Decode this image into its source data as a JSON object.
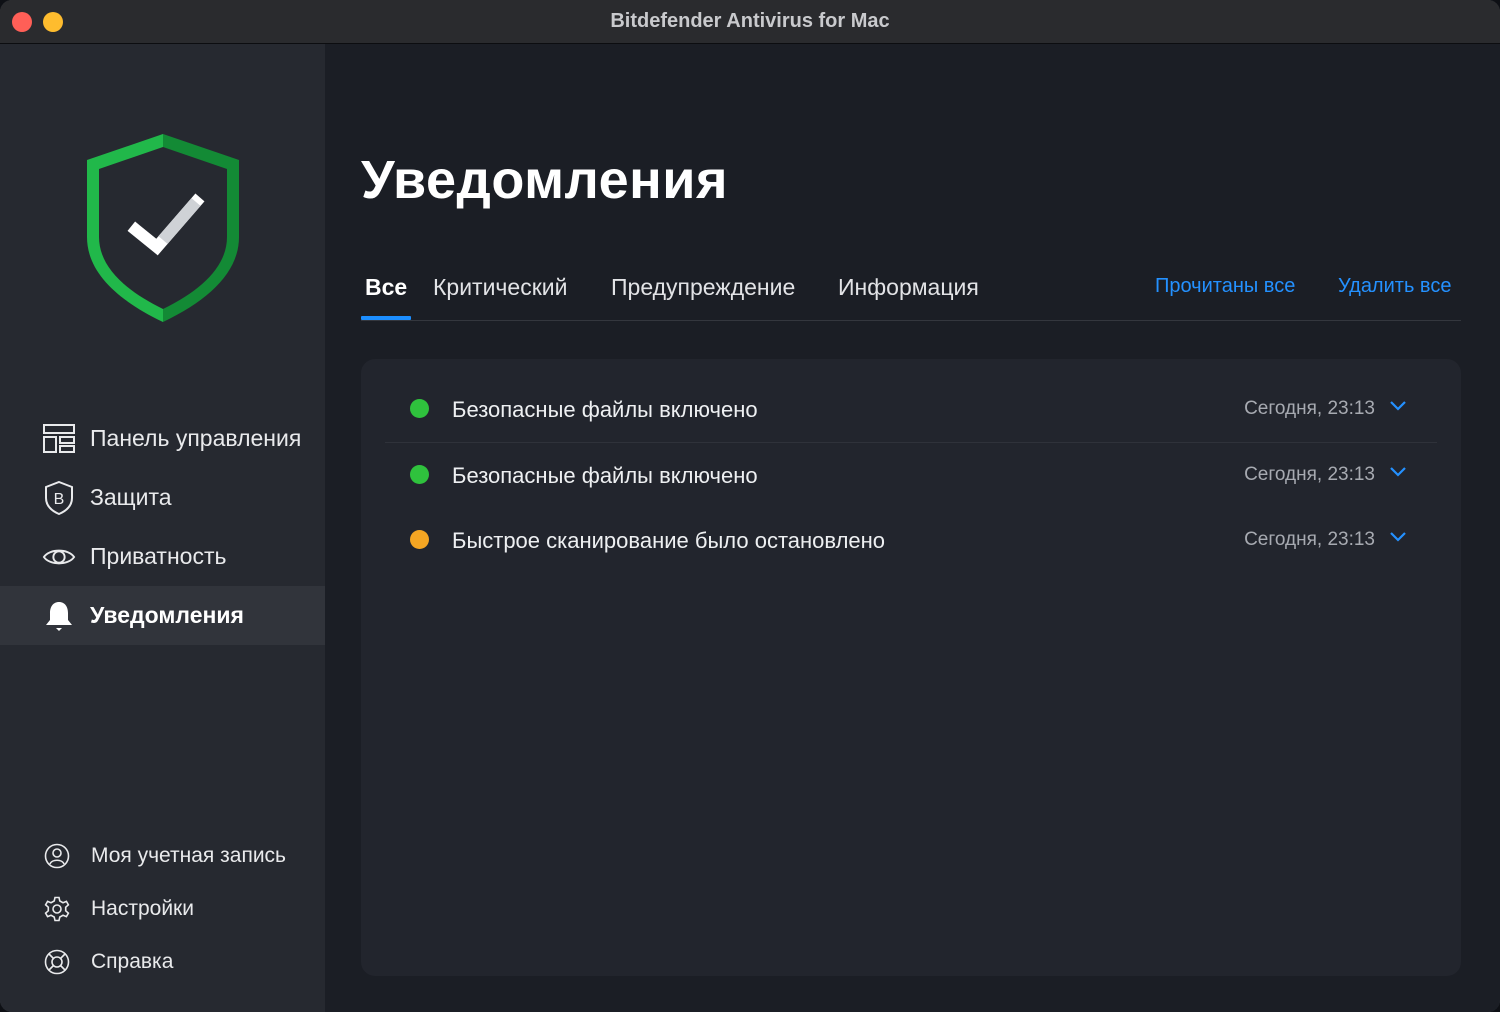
{
  "window": {
    "title": "Bitdefender Antivirus for Mac"
  },
  "sidebar": {
    "logo_icon": "shield-check-icon",
    "nav": [
      {
        "label": "Панель управления",
        "icon": "dashboard-icon"
      },
      {
        "label": "Защита",
        "icon": "protection-shield-icon"
      },
      {
        "label": "Приватность",
        "icon": "eye-icon"
      },
      {
        "label": "Уведомления",
        "icon": "bell-icon",
        "active": true
      }
    ],
    "bottom": [
      {
        "label": "Моя учетная запись",
        "icon": "account-icon"
      },
      {
        "label": "Настройки",
        "icon": "gear-icon"
      },
      {
        "label": "Справка",
        "icon": "help-lifebuoy-icon"
      }
    ]
  },
  "main": {
    "title": "Уведомления",
    "tabs": [
      {
        "label": "Все",
        "active": true
      },
      {
        "label": "Критический"
      },
      {
        "label": "Предупреждение"
      },
      {
        "label": "Информация"
      }
    ],
    "actions": {
      "mark_all_read": "Прочитаны все",
      "delete_all": "Удалить все"
    },
    "notifications": [
      {
        "text": "Безопасные файлы включено",
        "time": "Сегодня, 23:13",
        "status_color": "#2fc23d"
      },
      {
        "text": "Безопасные файлы включено",
        "time": "Сегодня, 23:13",
        "status_color": "#2fc23d"
      },
      {
        "text": "Быстрое сканирование было остановлено",
        "time": "Сегодня, 23:13",
        "status_color": "#f5a623"
      }
    ]
  },
  "colors": {
    "accent": "#1c8eff",
    "link": "#2491ff",
    "shield_green": "#1fb544"
  }
}
